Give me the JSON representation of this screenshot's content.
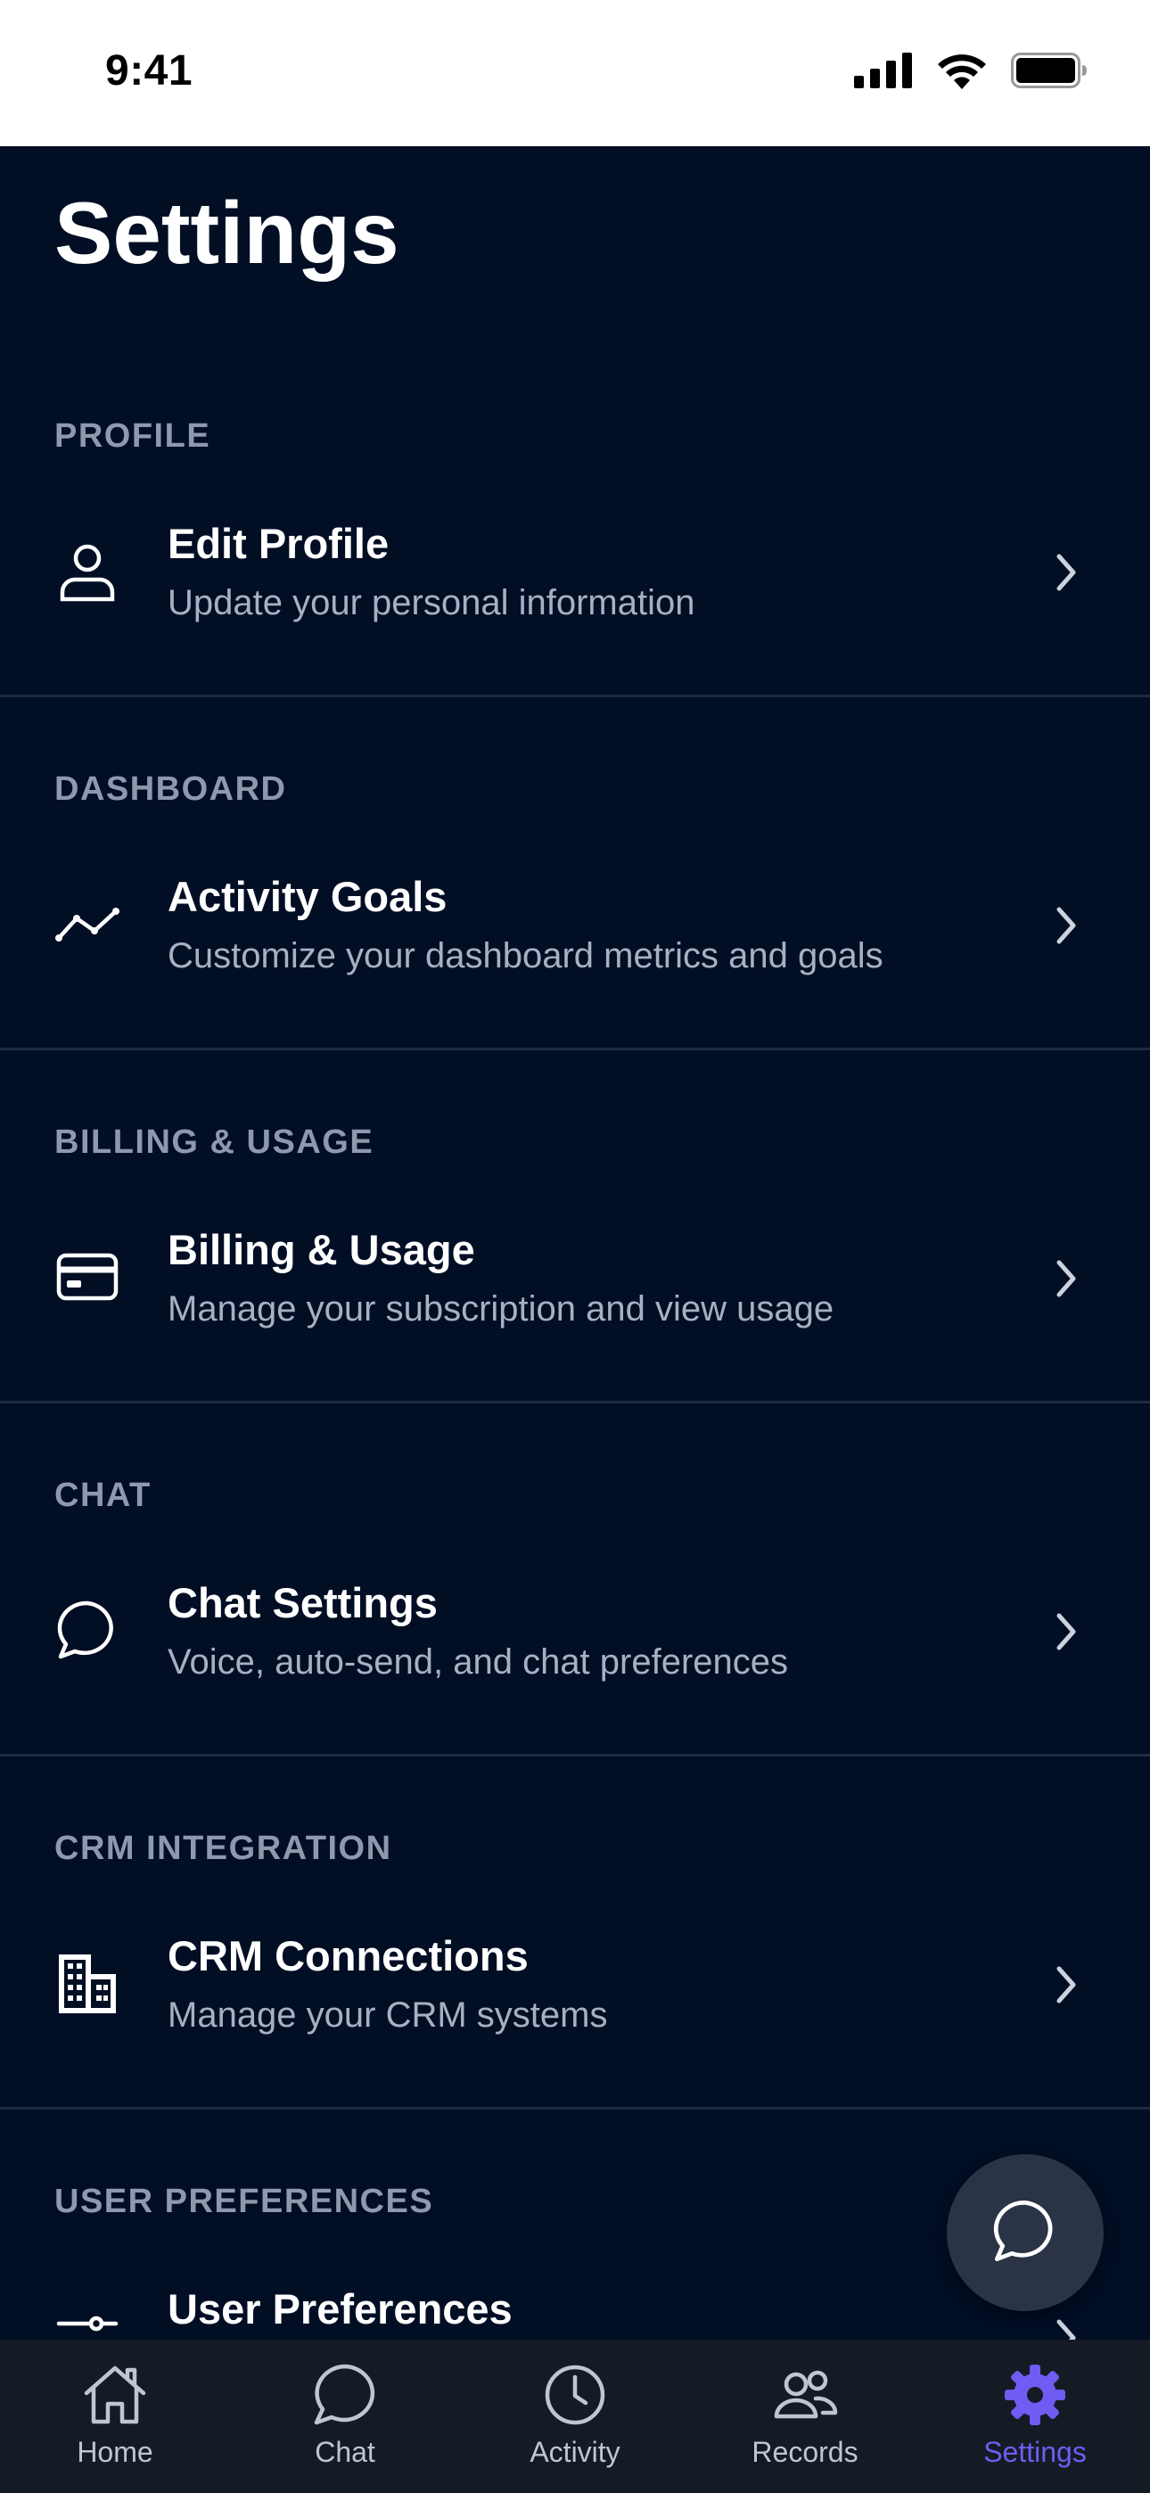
{
  "status_bar": {
    "time": "9:41"
  },
  "page": {
    "title": "Settings"
  },
  "sections": [
    {
      "header": "PROFILE",
      "item": {
        "title": "Edit Profile",
        "subtitle": "Update your personal information",
        "icon": "user-icon"
      }
    },
    {
      "header": "DASHBOARD",
      "item": {
        "title": "Activity Goals",
        "subtitle": "Customize your dashboard metrics and goals",
        "icon": "trend-line-icon"
      }
    },
    {
      "header": "BILLING & USAGE",
      "item": {
        "title": "Billing & Usage",
        "subtitle": "Manage your subscription and view usage",
        "icon": "credit-card-icon"
      }
    },
    {
      "header": "CHAT",
      "item": {
        "title": "Chat Settings",
        "subtitle": "Voice, auto-send, and chat preferences",
        "icon": "chat-bubble-icon"
      }
    },
    {
      "header": "CRM INTEGRATION",
      "item": {
        "title": "CRM Connections",
        "subtitle": "Manage your CRM systems",
        "icon": "building-icon"
      }
    },
    {
      "header": "USER PREFERENCES",
      "item": {
        "title": "User Preferences",
        "subtitle": "",
        "icon": "sliders-icon"
      }
    }
  ],
  "tabs": [
    {
      "label": "Home",
      "icon": "home-icon"
    },
    {
      "label": "Chat",
      "icon": "chat-bubble-icon"
    },
    {
      "label": "Activity",
      "icon": "clock-icon"
    },
    {
      "label": "Records",
      "icon": "people-icon"
    },
    {
      "label": "Settings",
      "icon": "gear-icon",
      "active": true
    }
  ],
  "colors": {
    "background": "#020e24",
    "section_header": "#8e99ad",
    "subtitle": "#a7b1c2",
    "divider": "#1c2a44",
    "tab_bar": "#151b25",
    "tab_inactive": "#c0c6d0",
    "accent": "#6f5cf2",
    "fab": "#2b3446"
  }
}
